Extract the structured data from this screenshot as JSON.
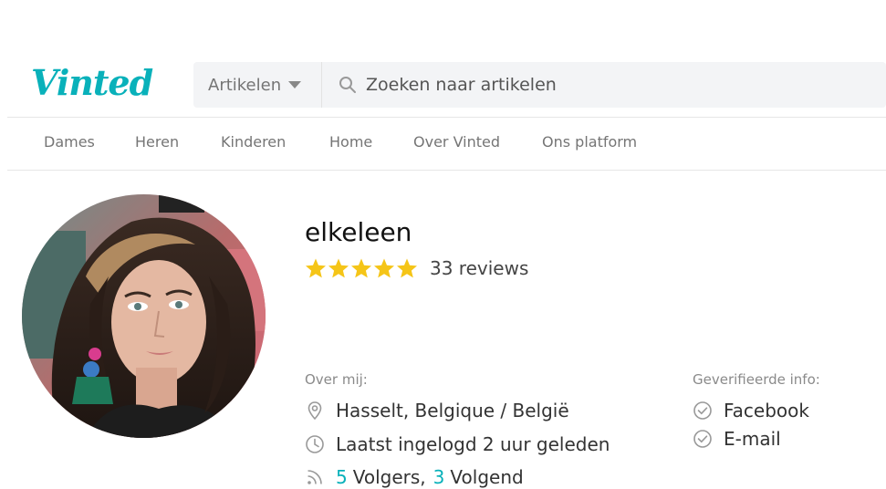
{
  "header": {
    "logo_text": "Vinted",
    "category_select": "Artikelen",
    "search_placeholder": "Zoeken naar artikelen"
  },
  "nav": {
    "items": [
      "Dames",
      "Heren",
      "Kinderen",
      "Home",
      "Over Vinted",
      "Ons platform"
    ]
  },
  "profile": {
    "username": "elkeleen",
    "rating_stars": 5,
    "reviews_label": "33 reviews",
    "about": {
      "label": "Over mij:",
      "location": "Hasselt, Belgique / België",
      "last_login": "Laatst ingelogd 2 uur geleden",
      "followers_count": "5",
      "followers_label": "Volgers,",
      "following_count": "3",
      "following_label": "Volgend"
    },
    "verified": {
      "label": "Geverifieerde info:",
      "items": [
        "Facebook",
        "E-mail"
      ]
    }
  },
  "colors": {
    "brand": "#09b1ba",
    "star": "#f5c518"
  }
}
